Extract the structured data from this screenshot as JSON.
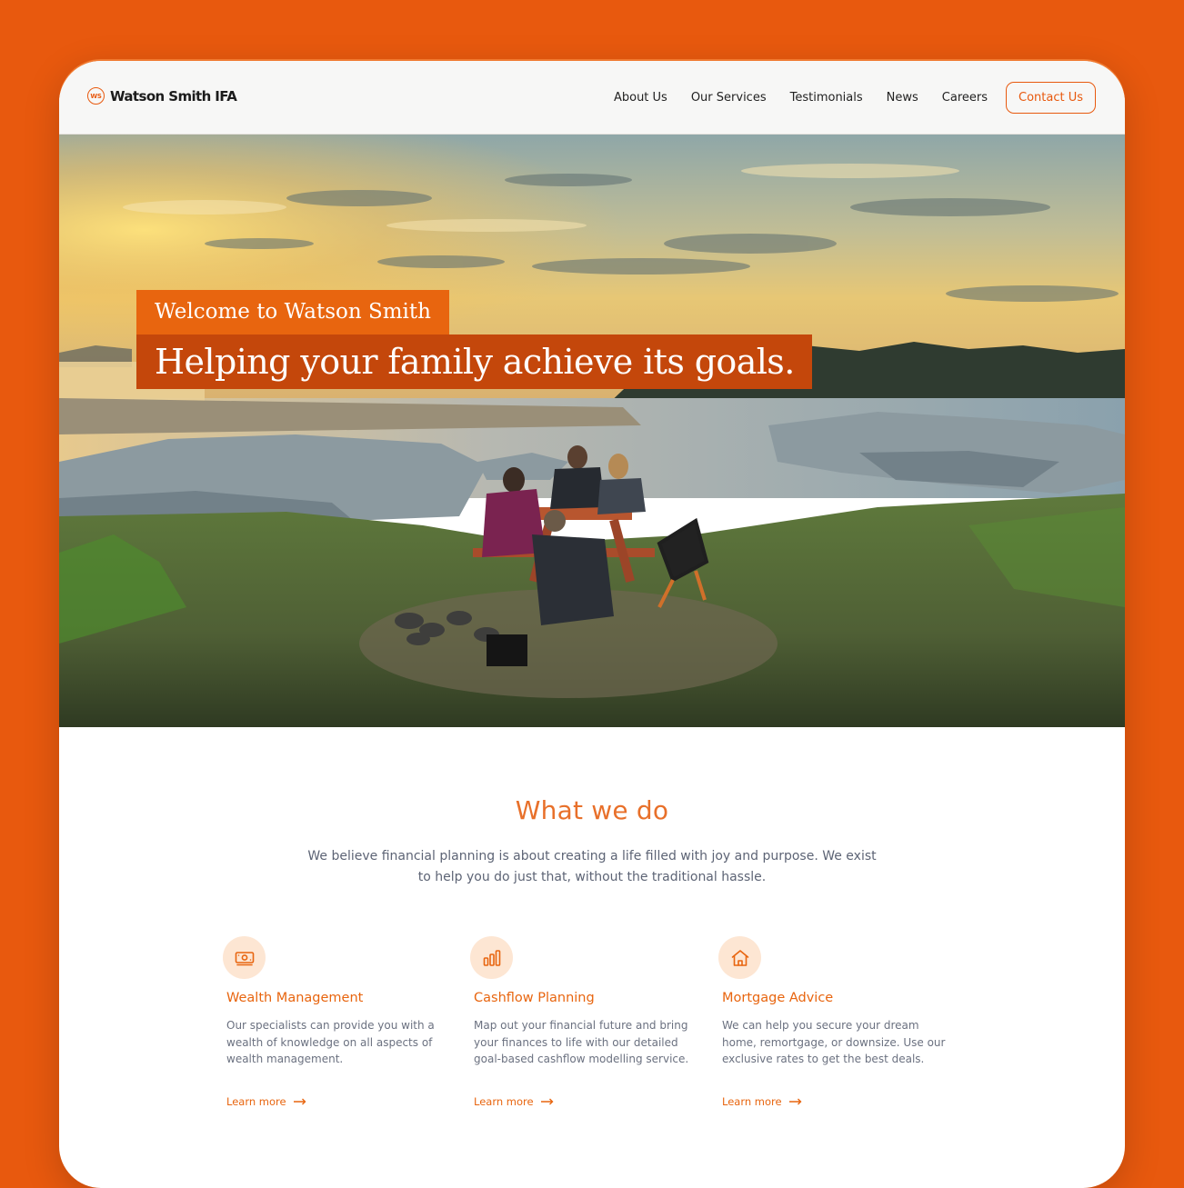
{
  "brand": {
    "logo_initials": "WS",
    "name": "Watson Smith IFA",
    "accent_color": "#E8590E"
  },
  "nav": {
    "items": [
      "About Us",
      "Our Services",
      "Testimonials",
      "News",
      "Careers"
    ],
    "cta_label": "Contact Us"
  },
  "hero": {
    "tagline": "Welcome to Watson Smith",
    "headline": "Helping your family achieve its goals."
  },
  "what_we_do": {
    "title": "What we do",
    "intro": "We believe financial planning is about creating a life filled with joy and purpose. We exist to help you do just that, without the traditional hassle.",
    "services": [
      {
        "icon": "money-icon",
        "title": "Wealth Management",
        "description": "Our specialists can provide you with a wealth of knowledge on all aspects of wealth management.",
        "link_label": "Learn more"
      },
      {
        "icon": "bar-chart-icon",
        "title": "Cashflow Planning",
        "description": "Map out your financial future and bring your finances to life with our detailed goal-based cashflow modelling service.",
        "link_label": "Learn more"
      },
      {
        "icon": "home-icon",
        "title": "Mortgage Advice",
        "description": "We can help you secure your dream home, remortgage, or downsize. Use our exclusive rates to get the best deals.",
        "link_label": "Learn more"
      }
    ]
  }
}
